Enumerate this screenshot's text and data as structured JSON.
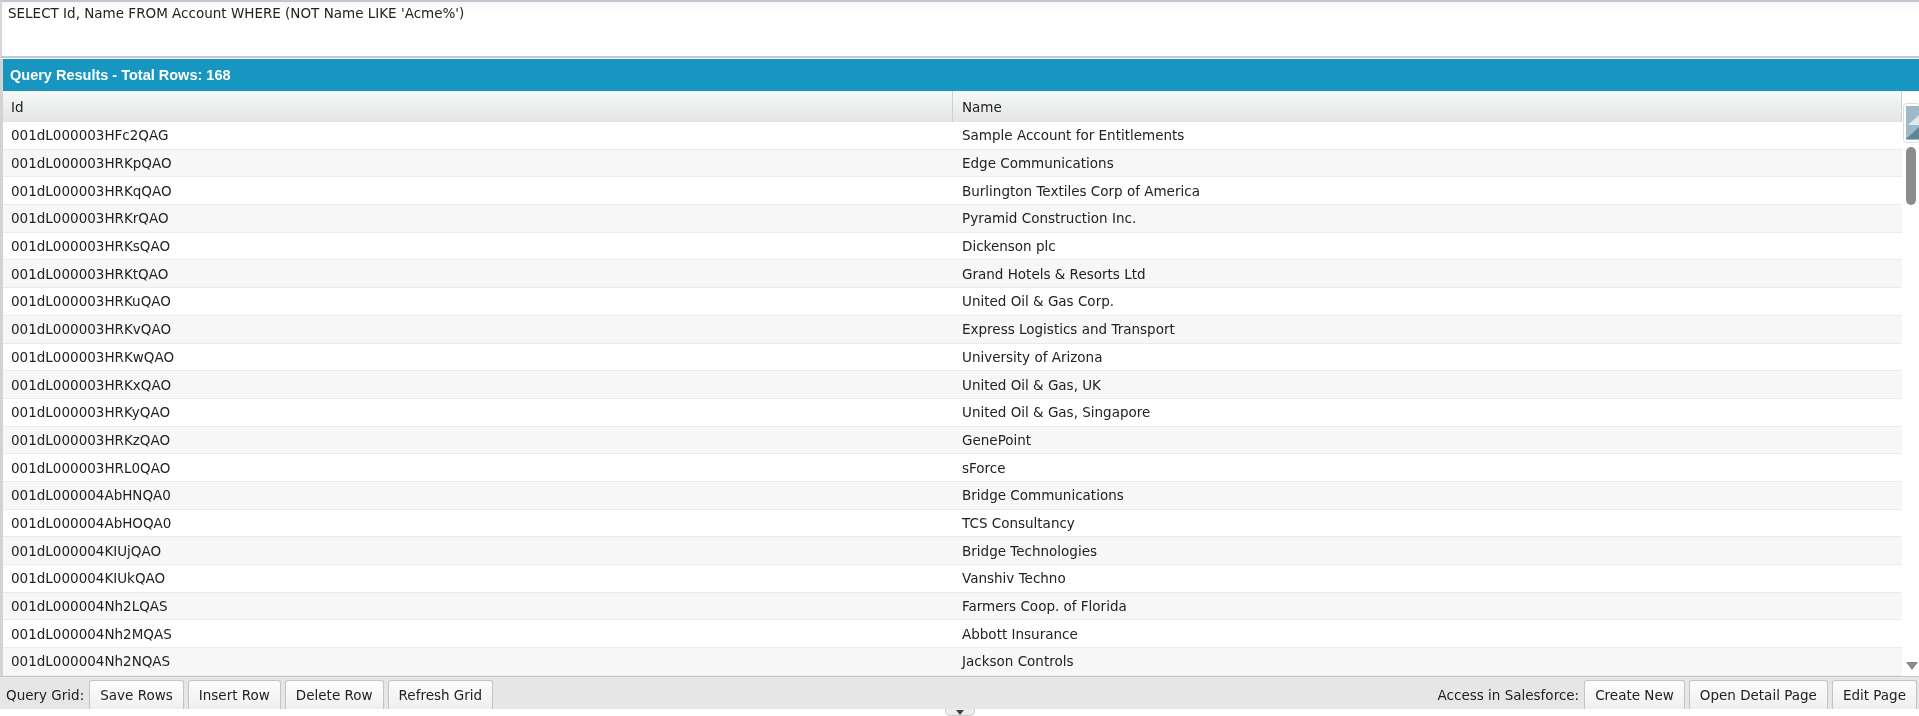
{
  "query_editor": {
    "value": "SELECT Id, Name FROM Account WHERE (NOT Name LIKE 'Acme%')"
  },
  "results": {
    "title": "Query Results - Total Rows: 168",
    "columns": [
      "Id",
      "Name"
    ],
    "rows": [
      [
        "001dL000003HFc2QAG",
        "Sample Account for Entitlements"
      ],
      [
        "001dL000003HRKpQAO",
        "Edge Communications"
      ],
      [
        "001dL000003HRKqQAO",
        "Burlington Textiles Corp of America"
      ],
      [
        "001dL000003HRKrQAO",
        "Pyramid Construction Inc."
      ],
      [
        "001dL000003HRKsQAO",
        "Dickenson plc"
      ],
      [
        "001dL000003HRKtQAO",
        "Grand Hotels & Resorts Ltd"
      ],
      [
        "001dL000003HRKuQAO",
        "United Oil & Gas Corp."
      ],
      [
        "001dL000003HRKvQAO",
        "Express Logistics and Transport"
      ],
      [
        "001dL000003HRKwQAO",
        "University of Arizona"
      ],
      [
        "001dL000003HRKxQAO",
        "United Oil & Gas, UK"
      ],
      [
        "001dL000003HRKyQAO",
        "United Oil & Gas, Singapore"
      ],
      [
        "001dL000003HRKzQAO",
        "GenePoint"
      ],
      [
        "001dL000003HRL0QAO",
        "sForce"
      ],
      [
        "001dL000004AbHNQA0",
        "Bridge Communications"
      ],
      [
        "001dL000004AbHOQA0",
        "TCS Consultancy"
      ],
      [
        "001dL000004KIUjQAO",
        "Bridge Technologies"
      ],
      [
        "001dL000004KIUkQAO",
        "Vanshiv Techno"
      ],
      [
        "001dL000004Nh2LQAS",
        "Farmers Coop. of Florida"
      ],
      [
        "001dL000004Nh2MQAS",
        "Abbott Insurance"
      ],
      [
        "001dL000004Nh2NQAS",
        "Jackson Controls"
      ]
    ]
  },
  "toolbar": {
    "left_label": "Query Grid:",
    "left_buttons": [
      "Save Rows",
      "Insert Row",
      "Delete Row",
      "Refresh Grid"
    ],
    "right_label": "Access in Salesforce:",
    "right_buttons": [
      "Create New",
      "Open Detail Page",
      "Edit Page"
    ]
  }
}
